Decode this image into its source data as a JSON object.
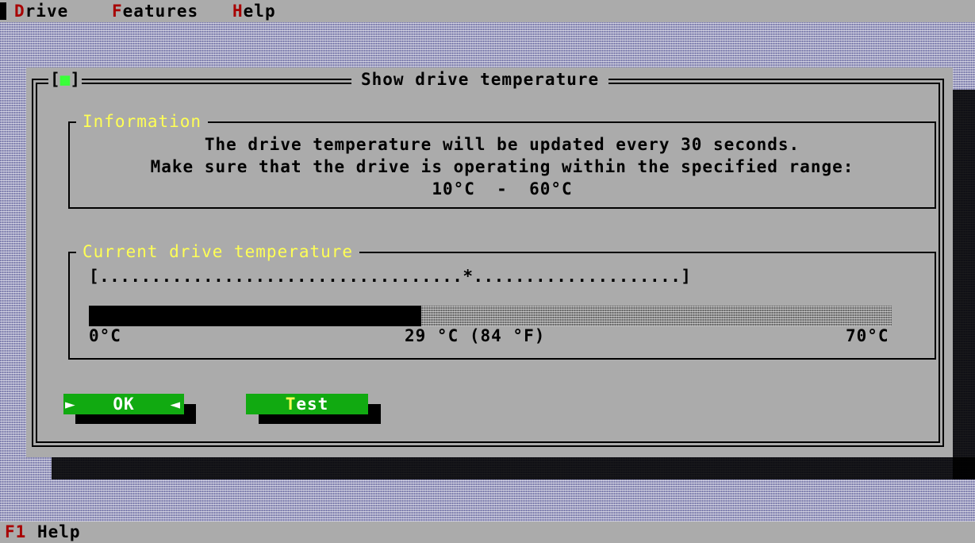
{
  "menu": {
    "items": [
      {
        "hotkey": "D",
        "rest": "rive"
      },
      {
        "hotkey": "F",
        "rest": "eatures"
      },
      {
        "hotkey": "H",
        "rest": "elp"
      }
    ]
  },
  "dialog": {
    "title": "Show drive temperature",
    "close_box_left": "[",
    "close_box_mark": "■",
    "close_box_right": "]",
    "info_group": {
      "title": "Information",
      "lines": [
        "The drive temperature will be updated every 30 seconds.",
        "Make sure that the drive is operating within the specified range:",
        "10°C  -  60°C"
      ]
    },
    "temp_group": {
      "title": "Current drive temperature",
      "scale": "[...................................*....................]",
      "min_label": "0°C",
      "current_label": "29 °C (84 °F)",
      "max_label": "70°C",
      "current_celsius": 29,
      "min_celsius": 0,
      "max_celsius": 70
    },
    "buttons": {
      "ok_left_marker": "►",
      "ok_label": "OK",
      "ok_right_marker": "◄",
      "test_hotkey": "T",
      "test_rest": "est"
    }
  },
  "status": {
    "key": "F1",
    "label": "Help"
  },
  "colors": {
    "hotkey_red": "#a80000",
    "title_yellow": "#ffff55",
    "button_green": "#11aa11",
    "panel_gray": "#ababab"
  }
}
